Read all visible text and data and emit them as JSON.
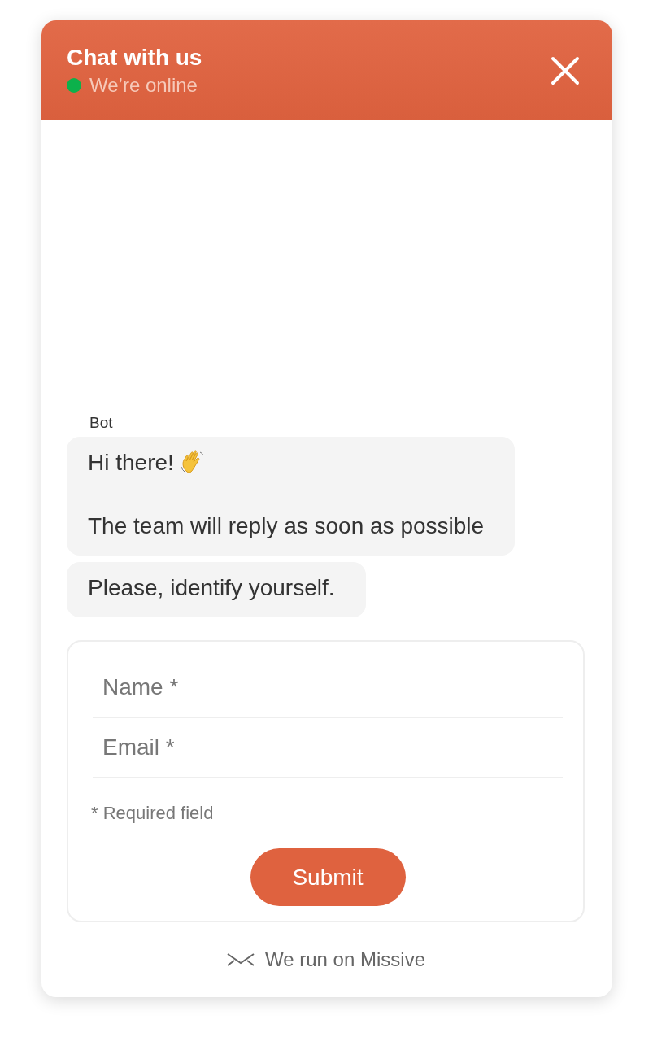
{
  "header": {
    "title": "Chat with us",
    "status": "We’re online",
    "online": true
  },
  "sender": "Bot",
  "messages": [
    {
      "paragraphs": [
        "Hi there!",
        "The team will reply as soon as possible"
      ],
      "wave": true
    },
    {
      "paragraphs": [
        "Please, identify yourself."
      ],
      "wave": false
    }
  ],
  "form": {
    "fields": [
      {
        "placeholder": "Name *"
      },
      {
        "placeholder": "Email *"
      }
    ],
    "note": "* Required field",
    "submit": "Submit"
  },
  "footer": "We run on Missive"
}
